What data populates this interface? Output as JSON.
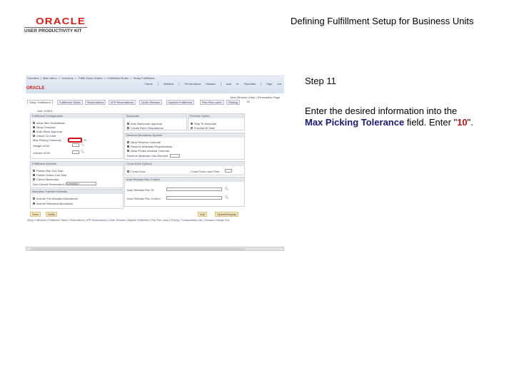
{
  "header": {
    "logo_brand": "ORACLE",
    "logo_product": "USER PRODUCTIVITY KIT",
    "title": "Defining Fulfillment Setup for Business Units"
  },
  "app": {
    "breadcrumb": [
      "Favorites",
      "Main Menu",
      "Inventory",
      "Fulfill Stock Orders",
      "Fulfillment Rules",
      "Setup Fulfillment"
    ],
    "nav": [
      "Home",
      "Worklist",
      "Performance Monitor",
      "Add to Favorites",
      "Sign out"
    ],
    "brand": "ORACLE",
    "page_links": "New Window | Help | Personalize Page",
    "tabs": [
      "Setup Fulfillment",
      "Fulfillment Tasks",
      "Reservations",
      "ATP Reservations",
      "Order Release",
      "Deplete Fulfillment",
      "Pick Plan Label",
      "Picking",
      "ID"
    ],
    "unit_label": "Unit:",
    "unit_value": "US001",
    "fulfillment_config": {
      "title": "Fulfillment Configuration",
      "items": [
        {
          "label": "Allow Item Substitution",
          "checked": false
        },
        {
          "label": "Allow Overpick",
          "checked": true
        },
        {
          "label": "Auto Stock Approval",
          "checked": true
        },
        {
          "label": "Check On Hold",
          "checked": false
        }
      ],
      "max_picking_label": "Max Picking Tolerance",
      "max_picking_unit": "%",
      "weight_uom": "Weight UOM",
      "volume_uom": "Volume UOM"
    },
    "backorder": {
      "title": "Backorder",
      "items": [
        {
          "label": "Auto Backorder Approval",
          "checked": false
        },
        {
          "label": "Create Refer Requisitions",
          "checked": false
        }
      ]
    },
    "promise": {
      "title": "Promise Option",
      "options": [
        {
          "label": "Ship To Schedule",
          "selected": true
        },
        {
          "label": "Promise At Date",
          "selected": false
        }
      ]
    },
    "reservations": {
      "title": "Reserve Allocations Options",
      "items": [
        {
          "label": "Allow Reserve Override",
          "checked": false
        },
        {
          "label": "Reserve Materials Requirements",
          "checked": true
        },
        {
          "label": "Allow Phase Modular Override",
          "checked": false
        }
      ],
      "field": "Reserve Materials Calc Element"
    },
    "fulfillment_defaults": {
      "title": "Fulfillment Defaults",
      "items": [
        {
          "label": "Partial Ship Doc Skip",
          "checked": false
        },
        {
          "label": "Partial Orders Can Ship",
          "checked": true
        },
        {
          "label": "Cancel Backorder",
          "checked": false
        }
      ],
      "select_label": "Non-Owned Reservation Credit",
      "select_value": "Unlimited"
    },
    "cross_dock": {
      "title": "Cross Dock Options",
      "checkbox": "Cross Dock",
      "field": "Cross Dock Lead Time"
    },
    "release": {
      "title": "Auto Release Run Control",
      "fields": [
        "Auto Release Run ID",
        "Auto Release Run Control"
      ]
    },
    "allocation": {
      "title": "Allocation Transfer Defaults",
      "items": [
        {
          "label": "Include Pre Allocated Allocations",
          "checked": false
        },
        {
          "label": "Include Released Allocations",
          "checked": true
        }
      ]
    },
    "buttons": {
      "save": "Save",
      "notify": "Notify",
      "add": "Add",
      "update": "Update/Display"
    },
    "footer_links": "Setup Fulfillment | Fulfillment Tasks | Reservations | ATP Reservations | Order Release | Deplete Fulfillment | Pick Plan Label | Picking | Transportation Info | Demand Change Cntl"
  },
  "instruction": {
    "step": "Step 11",
    "pre": "Enter the desired information into the ",
    "field": "Max Picking Tolerance",
    "mid": " field. Enter \"",
    "value": "10",
    "post": "\"."
  }
}
